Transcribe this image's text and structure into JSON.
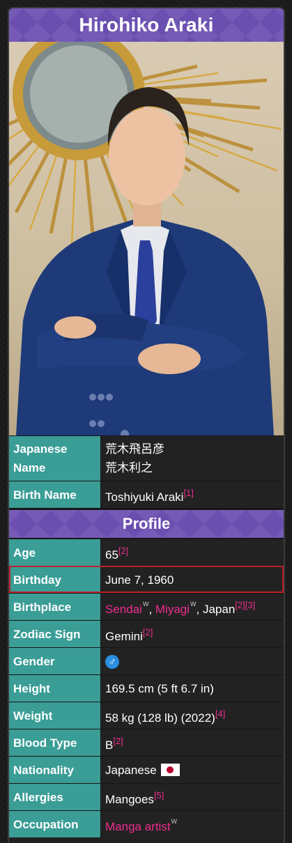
{
  "title": "Hirohiko Araki",
  "rows_top": [
    {
      "label": "Japanese Name",
      "values": [
        "荒木飛呂彦",
        "荒木利之"
      ]
    },
    {
      "label": "Birth Name",
      "text": "Toshiyuki Araki",
      "ref": "[1]"
    }
  ],
  "section_profile": "Profile",
  "age": {
    "label": "Age",
    "value": "65",
    "ref": "[2]"
  },
  "birthday": {
    "label": "Birthday",
    "value": "June 7, 1960"
  },
  "birthplace": {
    "label": "Birthplace",
    "city": "Sendai",
    "prefecture": "Miyagi",
    "rest": ", Japan",
    "ref1": "[2]",
    "ref2": "[3]",
    "wiki_mark": "W",
    "sep": ", "
  },
  "zodiac": {
    "label": "Zodiac Sign",
    "value": "Gemini",
    "ref": "[2]"
  },
  "gender": {
    "label": "Gender",
    "symbol": "♂"
  },
  "height": {
    "label": "Height",
    "value": "169.5 cm (5 ft 6.7 in)"
  },
  "weight": {
    "label": "Weight",
    "value": "58 kg (128 lb) (2022)",
    "ref": "[4]"
  },
  "blood": {
    "label": "Blood Type",
    "value": "B",
    "ref": "[2]"
  },
  "nationality": {
    "label": "Nationality",
    "value": "Japanese"
  },
  "allergies": {
    "label": "Allergies",
    "value": "Mangoes",
    "ref": "[5]"
  },
  "occupation": {
    "label": "Occupation",
    "value": "Manga artist",
    "wiki_mark": "W"
  },
  "colors": {
    "accent_purple": "#6a4fb0",
    "label_teal": "#3a9d96",
    "link_pink": "#ef2d8f",
    "highlight_red": "#c0202a"
  }
}
